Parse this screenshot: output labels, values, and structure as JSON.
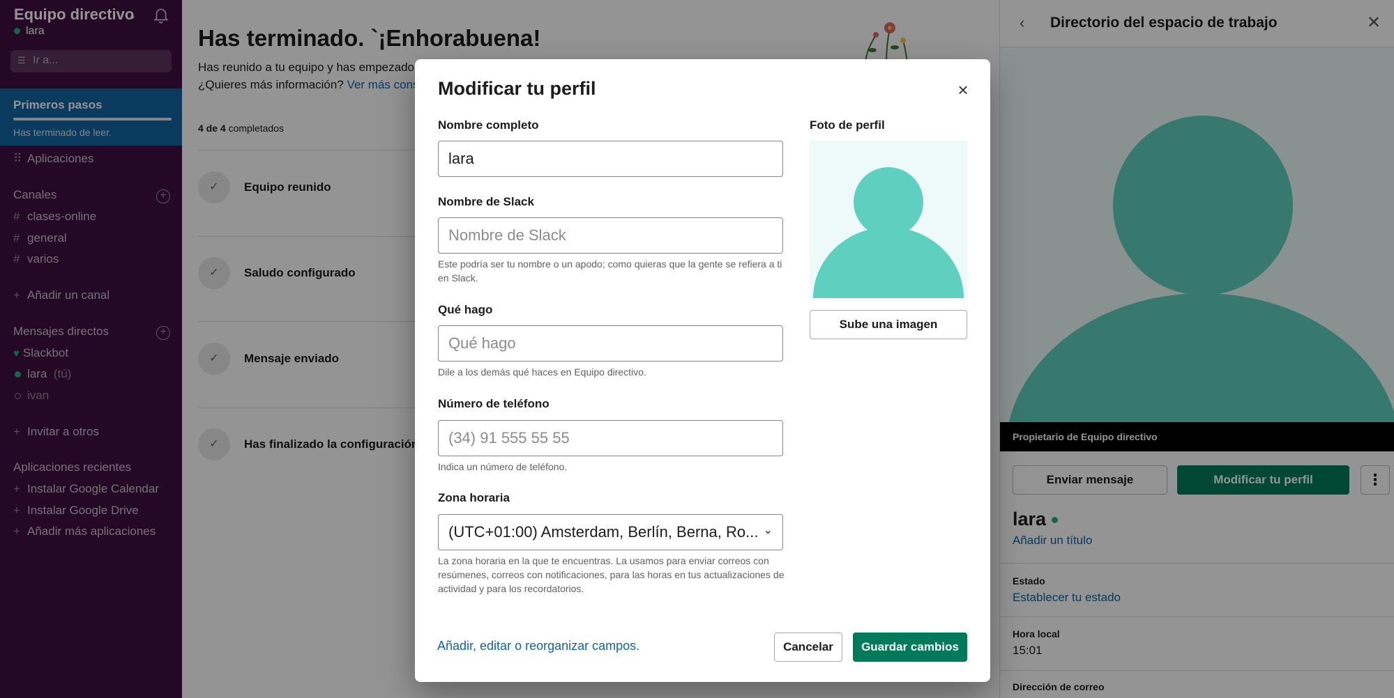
{
  "sidebar": {
    "workspace_name": "Equipo directivo",
    "user": "lara",
    "search_placeholder": "Ir a...",
    "active_item": {
      "label": "Primeros pasos",
      "sub": "Has terminado de leer."
    },
    "apps_label": "Aplicaciones",
    "channels_header": "Canales",
    "channels": [
      "clases-online",
      "general",
      "varios"
    ],
    "add_channel": "Añadir un canal",
    "dm_header": "Mensajes directos",
    "dms": {
      "slackbot": "Slackbot",
      "self_name": "lara",
      "self_suffix": "(tú)",
      "other": "ivan"
    },
    "invite": "Invitar a otros",
    "recent_apps_header": "Aplicaciones recientes",
    "recent_apps": [
      "Instalar Google Calendar",
      "Instalar Google Drive",
      "Añadir más aplicaciones"
    ]
  },
  "main": {
    "title": "Has terminado. `¡Enhorabuena!",
    "desc_line1": "Has reunido a tu equipo y has empezado",
    "desc_line2": "¿Quieres más información?",
    "desc_link": "Ver más cons",
    "progress_bold": "4 de 4",
    "progress_rest": "completados",
    "steps": [
      "Equipo reunido",
      "Saludo configurado",
      "Mensaje enviado",
      "Has finalizado la configuración"
    ]
  },
  "panel": {
    "title": "Directorio del espacio de trabajo",
    "owner_label": "Propietario de Equipo directivo",
    "send_message": "Enviar mensaje",
    "edit_profile": "Modificar tu perfil",
    "name": "lara",
    "add_title": "Añadir un título",
    "status_label": "Estado",
    "status_link": "Establecer tu estado",
    "local_time_label": "Hora local",
    "local_time": "15:01",
    "email_label": "Dirección de correo"
  },
  "modal": {
    "title": "Modificar tu perfil",
    "full_name_label": "Nombre completo",
    "full_name_value": "lara",
    "slack_name_label": "Nombre de Slack",
    "slack_name_placeholder": "Nombre de Slack",
    "slack_name_help": "Este podría ser tu nombre o un apodo; como quieras que la gente se refiera a ti en Slack.",
    "what_i_do_label": "Qué hago",
    "what_i_do_placeholder": "Qué hago",
    "what_i_do_help": "Dile a los demás qué haces en Equipo directivo.",
    "phone_label": "Número de teléfono",
    "phone_placeholder": "(34) 91 555 55 55",
    "phone_help": "Indica un número de teléfono.",
    "timezone_label": "Zona horaria",
    "timezone_value": "(UTC+01:00) Amsterdam, Berlín, Berna, Ro...",
    "timezone_help": "La zona horaria en la que te encuentras. La usamos para enviar correos con resúmenes, correos con notificaciones, para las horas en tus actualizaciones de actividad y para los recordatorios.",
    "photo_label": "Foto de perfil",
    "upload_button": "Sube una imagen",
    "fields_link": "Añadir, editar o reorganizar campos.",
    "cancel": "Cancelar",
    "save": "Guardar cambios"
  },
  "colors": {
    "sidebar_bg": "#3f0e40",
    "active_item": "#1264a3",
    "primary_green": "#007a5a",
    "avatar_teal": "#5fcfc0",
    "presence_green": "#2bac76",
    "link_blue": "#1264a3"
  },
  "icons": [
    "bell-icon",
    "search-icon",
    "add-circle-icon",
    "hash-icon",
    "plus-icon",
    "check-icon",
    "close-icon",
    "back-chevron-icon",
    "more-icon",
    "chevron-down-icon",
    "heart-icon",
    "apps-grid-icon"
  ]
}
